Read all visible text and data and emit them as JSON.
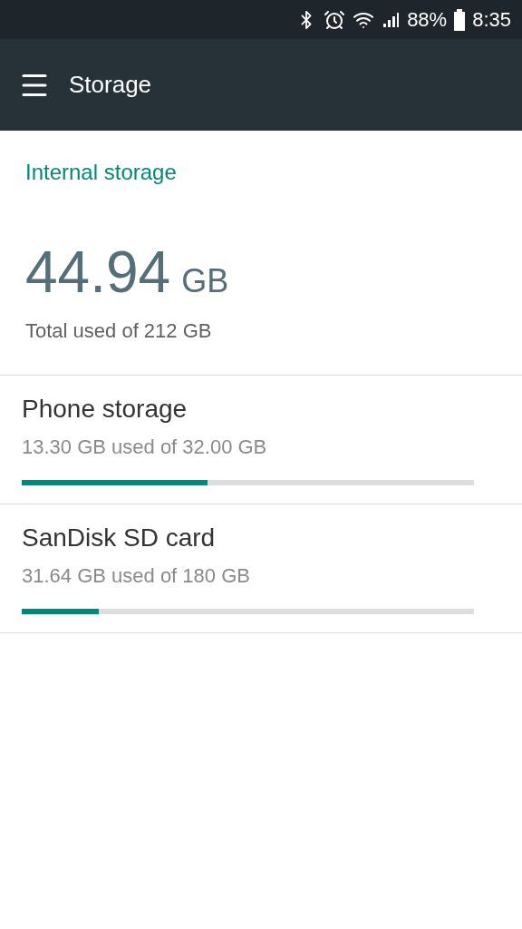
{
  "status_bar": {
    "battery_text": "88%",
    "time": "8:35"
  },
  "app_bar": {
    "title": "Storage"
  },
  "section": {
    "title": "Internal storage",
    "total": "44.94",
    "unit": "GB",
    "caption": "Total used of 212 GB"
  },
  "volumes": [
    {
      "name": "Phone storage",
      "usage": "13.30 GB used of 32.00 GB",
      "level": 0.41
    },
    {
      "name": "SanDisk SD card",
      "usage": "31.64 GB used of 180 GB",
      "level": 0.17
    }
  ]
}
